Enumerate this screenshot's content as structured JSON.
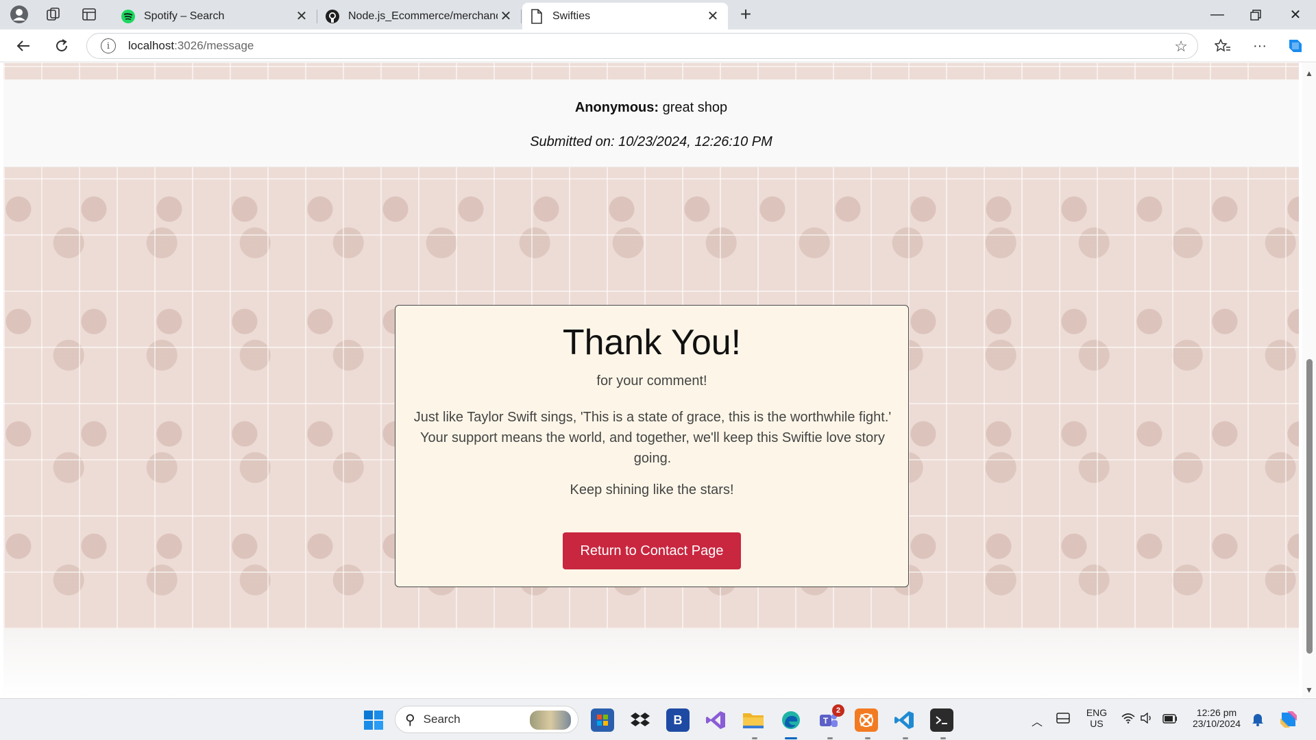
{
  "browser": {
    "tabs": [
      {
        "label": "Spotify – Search",
        "icon": "spotify-icon",
        "active": false
      },
      {
        "label": "Node.js_Ecommerce/merchandise",
        "icon": "github-icon",
        "active": false
      },
      {
        "label": "Swifties",
        "icon": "page-icon",
        "active": true
      }
    ],
    "url_host": "localhost",
    "url_path": ":3026/message"
  },
  "comment": {
    "author": "Anonymous:",
    "text": " great shop",
    "submitted": "Submitted on: 10/23/2024, 12:26:10 PM"
  },
  "thanks": {
    "title": "Thank You!",
    "subtitle": "for your comment!",
    "message": "Just like Taylor Swift sings, 'This is a state of grace, this is the worthwhile fight.' Your support means the world, and together, we'll keep this Swiftie love story going.",
    "closing": "Keep shining like the stars!",
    "button_label": "Return to Contact Page"
  },
  "taskbar": {
    "search_label": "Search",
    "lang_top": "ENG",
    "lang_bottom": "US",
    "time": "12:26 pm",
    "date": "23/10/2024",
    "teams_badge": "2"
  },
  "colors": {
    "accent_button": "#c9263f",
    "card_background": "#fdf6e8"
  }
}
